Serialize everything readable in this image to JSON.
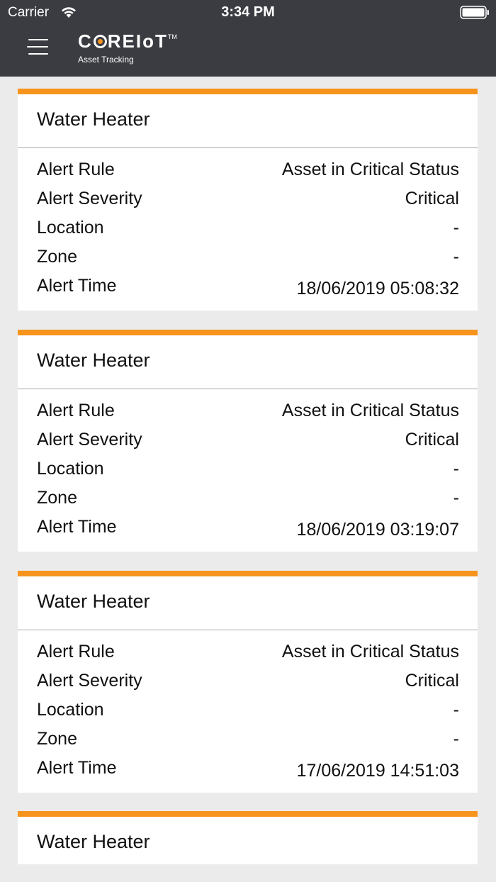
{
  "status_bar": {
    "carrier": "Carrier",
    "time": "3:34 PM"
  },
  "header": {
    "logo_text_pre": "C",
    "logo_text_post": "REIoT",
    "logo_tm": "TM",
    "logo_subtitle": "Asset Tracking"
  },
  "alerts": [
    {
      "title": "Water Heater",
      "rows": [
        {
          "label": "Alert Rule",
          "value": "Asset in Critical Status"
        },
        {
          "label": "Alert Severity",
          "value": "Critical"
        },
        {
          "label": "Location",
          "value": "-"
        },
        {
          "label": "Zone",
          "value": "-"
        },
        {
          "label": "Alert Time",
          "value": "18/06/2019 05:08:32"
        }
      ]
    },
    {
      "title": "Water Heater",
      "rows": [
        {
          "label": "Alert Rule",
          "value": "Asset in Critical Status"
        },
        {
          "label": "Alert Severity",
          "value": "Critical"
        },
        {
          "label": "Location",
          "value": "-"
        },
        {
          "label": "Zone",
          "value": "-"
        },
        {
          "label": "Alert Time",
          "value": "18/06/2019 03:19:07"
        }
      ]
    },
    {
      "title": "Water Heater",
      "rows": [
        {
          "label": "Alert Rule",
          "value": "Asset in Critical Status"
        },
        {
          "label": "Alert Severity",
          "value": "Critical"
        },
        {
          "label": "Location",
          "value": "-"
        },
        {
          "label": "Zone",
          "value": "-"
        },
        {
          "label": "Alert Time",
          "value": "17/06/2019 14:51:03"
        }
      ]
    },
    {
      "title": "Water Heater",
      "rows": []
    }
  ],
  "colors": {
    "accent": "#f7941d",
    "header_bg": "#3b3c41",
    "page_bg": "#ebebeb"
  }
}
